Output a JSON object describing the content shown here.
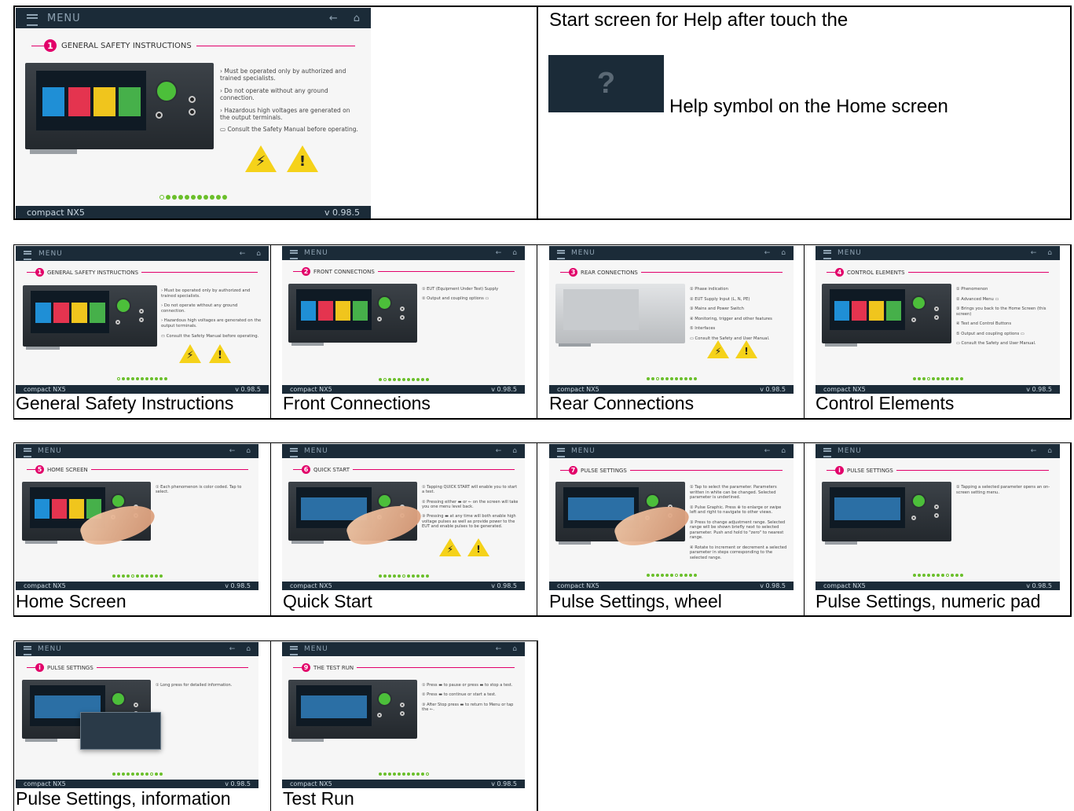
{
  "top": {
    "description_line1": "Start screen for Help after touch the",
    "description_line2": "Help symbol on the Home screen",
    "help_symbol": "?"
  },
  "device_ui": {
    "menu_label": "MENU",
    "back_icon": "←",
    "home_icon": "⌂",
    "product": "compact NX5",
    "version": "v 0.98.5"
  },
  "screens": [
    {
      "id": "hero",
      "number": "1",
      "title": "GENERAL SAFETY INSTRUCTIONS",
      "bullets": [
        "› Must be operated only by authorized and trained specialists.",
        "› Do not operate without any ground connection.",
        "› Hazardous high voltages are generated on the output terminals.",
        "▭ Consult the Safety Manual before operating."
      ],
      "warnings": true,
      "current_dot": 0
    },
    {
      "id": "gsi",
      "number": "1",
      "title": "GENERAL SAFETY INSTRUCTIONS",
      "caption": "General Safety Instructions",
      "bullets": [
        "› Must be operated only by authorized and trained specialists.",
        "› Do not operate without any ground connection.",
        "› Hazardous high voltages are generated on the output terminals.",
        "▭ Consult the Safety Manual before operating."
      ],
      "warnings": true,
      "current_dot": 0
    },
    {
      "id": "front",
      "number": "2",
      "title": "FRONT CONNECTIONS",
      "caption": "Front Connections",
      "bullets": [
        "① EUT (Equipment Under Test) Supply",
        "② Output and coupling options ▭"
      ],
      "warnings": false,
      "current_dot": 1
    },
    {
      "id": "rear",
      "number": "3",
      "title": "REAR CONNECTIONS",
      "caption": "Rear Connections",
      "bullets": [
        "① Phase indication",
        "② EUT Supply Input (L, N, PE)",
        "③ Mains and Power Switch",
        "④ Monitoring, trigger and other features",
        "⑤ Interfaces",
        "▭ Consult the Safety and User Manual."
      ],
      "warnings": true,
      "current_dot": 2
    },
    {
      "id": "control",
      "number": "4",
      "title": "CONTROL ELEMENTS",
      "caption": "Control Elements",
      "bullets": [
        "① Phenomenon",
        "② Advanced Menu ▭",
        "③ Brings you back to the Home Screen (this screen)",
        "④ Test and Control Buttons",
        "⑤ Output and coupling options ▭",
        "▭ Consult the Safety and User Manual."
      ],
      "warnings": false,
      "current_dot": 3
    },
    {
      "id": "home",
      "number": "5",
      "title": "HOME SCREEN",
      "caption": "Home Screen",
      "bullets": [
        "① Each phenomenon is color coded. Tap to select."
      ],
      "warnings": false,
      "current_dot": 4,
      "hand": true
    },
    {
      "id": "quick",
      "number": "6",
      "title": "QUICK START",
      "caption": "Quick Start",
      "bullets": [
        "① Tapping QUICK START will enable you to start a test.",
        "② Pressing either ▬ or ← on the screen will take you one menu level back.",
        "③ Pressing ▬ at any time will both enable high voltage pulses as well as provide power to the EUT and enable pulses to be generated."
      ],
      "warnings": true,
      "current_dot": 5,
      "hand": true
    },
    {
      "id": "wheel",
      "number": "7",
      "title": "PULSE SETTINGS",
      "caption": "Pulse Settings, wheel",
      "bullets": [
        "① Tap to select the parameter. Parameters written in white can be changed. Selected parameter is underlined.",
        "② Pulse Graphic. Press ⊕ to enlarge or swipe left and right to navigate to other views.",
        "③ Press to change adjustment range. Selected range will be shown briefly next to selected parameter. Push and hold to \"zero\" to nearest range.",
        "④ Rotate to increment or decrement a selected parameter in steps corresponding to the selected range."
      ],
      "warnings": false,
      "current_dot": 6,
      "hand": true
    },
    {
      "id": "numpad",
      "number": "i",
      "title": "PULSE SETTINGS",
      "caption": "Pulse Settings, numeric pad",
      "bullets": [
        "① Tapping a selected parameter opens an on-screen setting menu."
      ],
      "warnings": false,
      "current_dot": 7
    },
    {
      "id": "info",
      "number": "i",
      "title": "PULSE SETTINGS",
      "caption": "Pulse Settings, information",
      "bullets": [
        "① Long press for detailed information."
      ],
      "warnings": false,
      "current_dot": 8,
      "popup": true
    },
    {
      "id": "testrun",
      "number": "9",
      "title": "THE TEST RUN",
      "caption": "Test Run",
      "bullets": [
        "① Press ▬ to pause or press ▬ to stop a test.",
        "② Press ▬ to continue or start a test.",
        "③ After Stop press ▬ to return to Menu or tap the ←."
      ],
      "warnings": false,
      "current_dot": 10
    }
  ],
  "colors": {
    "bar": "#1b2b38",
    "accent": "#e2006a",
    "dots": "#6abf2a",
    "tiles": [
      "#1f8fd6",
      "#e4344f",
      "#f0c51d",
      "#46b04a"
    ]
  }
}
